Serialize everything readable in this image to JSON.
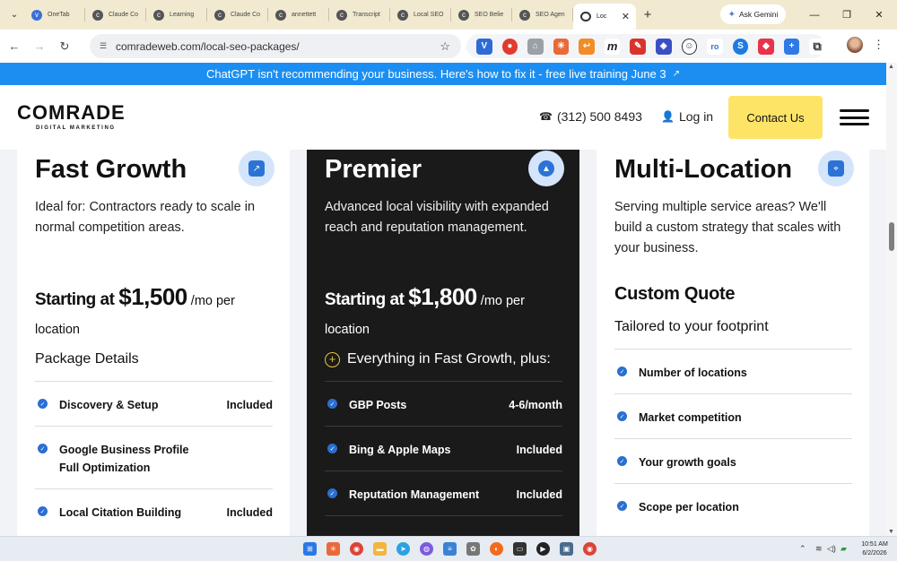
{
  "browser": {
    "tabs": [
      {
        "label": "OneTab",
        "color": "#3a6fd8",
        "icon": "v"
      },
      {
        "label": "Claude Co",
        "color": "#555555",
        "icon": "c"
      },
      {
        "label": "Learning",
        "color": "#555555",
        "icon": "c"
      },
      {
        "label": "Claude Co",
        "color": "#555555",
        "icon": "c"
      },
      {
        "label": "annettett",
        "color": "#555555",
        "icon": "c"
      },
      {
        "label": "Transcript",
        "color": "#555555",
        "icon": "c"
      },
      {
        "label": "Local SEO",
        "color": "#555555",
        "icon": "c"
      },
      {
        "label": "SEO Belie",
        "color": "#555555",
        "icon": "c"
      },
      {
        "label": "SEO Agen",
        "color": "#555555",
        "icon": "c"
      }
    ],
    "active_tab": {
      "label": "Loc",
      "close": "✕"
    },
    "new_tab": "+",
    "ask_gemini": "Ask Gemini",
    "window_controls": {
      "minimize": "—",
      "restore": "❐",
      "close": "✕"
    },
    "url": "comradeweb.com/local-seo-packages/"
  },
  "banner": {
    "text": "ChatGPT isn't recommending your business. Here's how to fix it - free live training June 3",
    "arrow": "↗"
  },
  "header": {
    "logo": "COMRADE",
    "logo_sub": "DIGITAL MARKETING",
    "phone": "(312) 500 8493",
    "login": "Log in",
    "contact": "Contact Us"
  },
  "cards": [
    {
      "title": "Fast Growth",
      "description": "Ideal for: Contractors ready to scale in normal competition areas.",
      "price_lead": "Starting at ",
      "price_amount": "$1,500",
      "price_unit": " /mo per location",
      "section": "Package Details",
      "features": [
        {
          "name": "Discovery & Setup",
          "value": "Included"
        },
        {
          "name": "Google Business Profile Full Optimization",
          "value": ""
        },
        {
          "name": "Local Citation Building",
          "value": "Included"
        }
      ]
    },
    {
      "title": "Premier",
      "description": "Advanced local visibility with expanded reach and reputation management.",
      "price_lead": "Starting at ",
      "price_amount": "$1,800",
      "price_unit": " /mo per location",
      "section": "Everything in Fast Growth, plus:",
      "section_icon": "+",
      "features": [
        {
          "name": "GBP Posts",
          "value": "4-6/month"
        },
        {
          "name": "Bing & Apple Maps",
          "value": "Included"
        },
        {
          "name": "Reputation Management",
          "value": "Included"
        }
      ]
    },
    {
      "title": "Multi-Location",
      "description": "Serving multiple service areas? We'll build a custom strategy that scales with your business.",
      "quote": "Custom Quote",
      "section": "Tailored to your footprint",
      "features": [
        {
          "name": "Number of locations",
          "value": ""
        },
        {
          "name": "Market competition",
          "value": ""
        },
        {
          "name": "Your growth goals",
          "value": ""
        },
        {
          "name": "Scope per location",
          "value": ""
        }
      ]
    }
  ],
  "taskbar": {
    "clock_time": "10:51 AM",
    "clock_date": "6/2/2026"
  },
  "colors": {
    "banner": "#1c8ef1",
    "contact_button": "#fde467",
    "dark_card": "#1a1a1a",
    "check": "#2a6fd1"
  }
}
